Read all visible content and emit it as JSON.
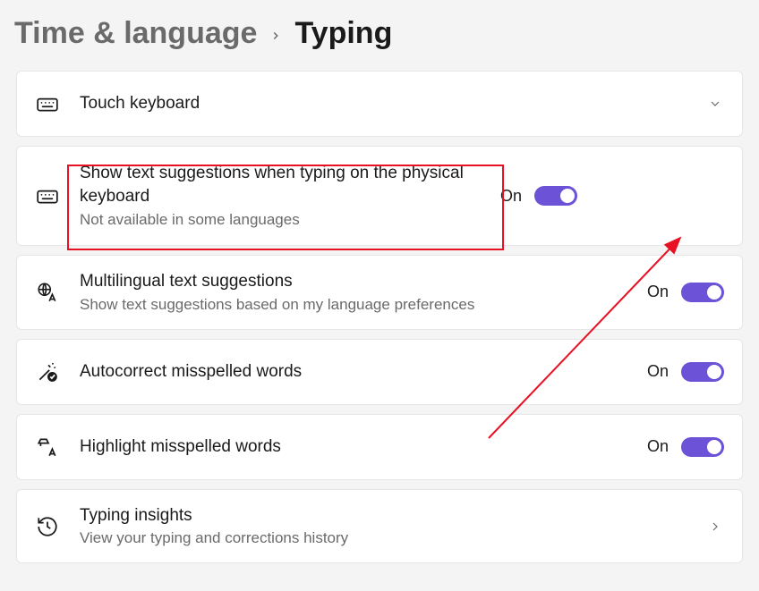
{
  "breadcrumb": {
    "parent": "Time & language",
    "current": "Typing"
  },
  "toggle_labels": {
    "on": "On"
  },
  "cards": {
    "touch_keyboard": {
      "title": "Touch keyboard"
    },
    "text_suggestions": {
      "title": "Show text suggestions when typing on the physical keyboard",
      "subtitle": "Not available in some languages",
      "state": "On"
    },
    "multilingual": {
      "title": "Multilingual text suggestions",
      "subtitle": "Show text suggestions based on my language preferences",
      "state": "On"
    },
    "autocorrect": {
      "title": "Autocorrect misspelled words",
      "state": "On"
    },
    "highlight_misspelled": {
      "title": "Highlight misspelled words",
      "state": "On"
    },
    "typing_insights": {
      "title": "Typing insights",
      "subtitle": "View your typing and corrections history"
    }
  }
}
